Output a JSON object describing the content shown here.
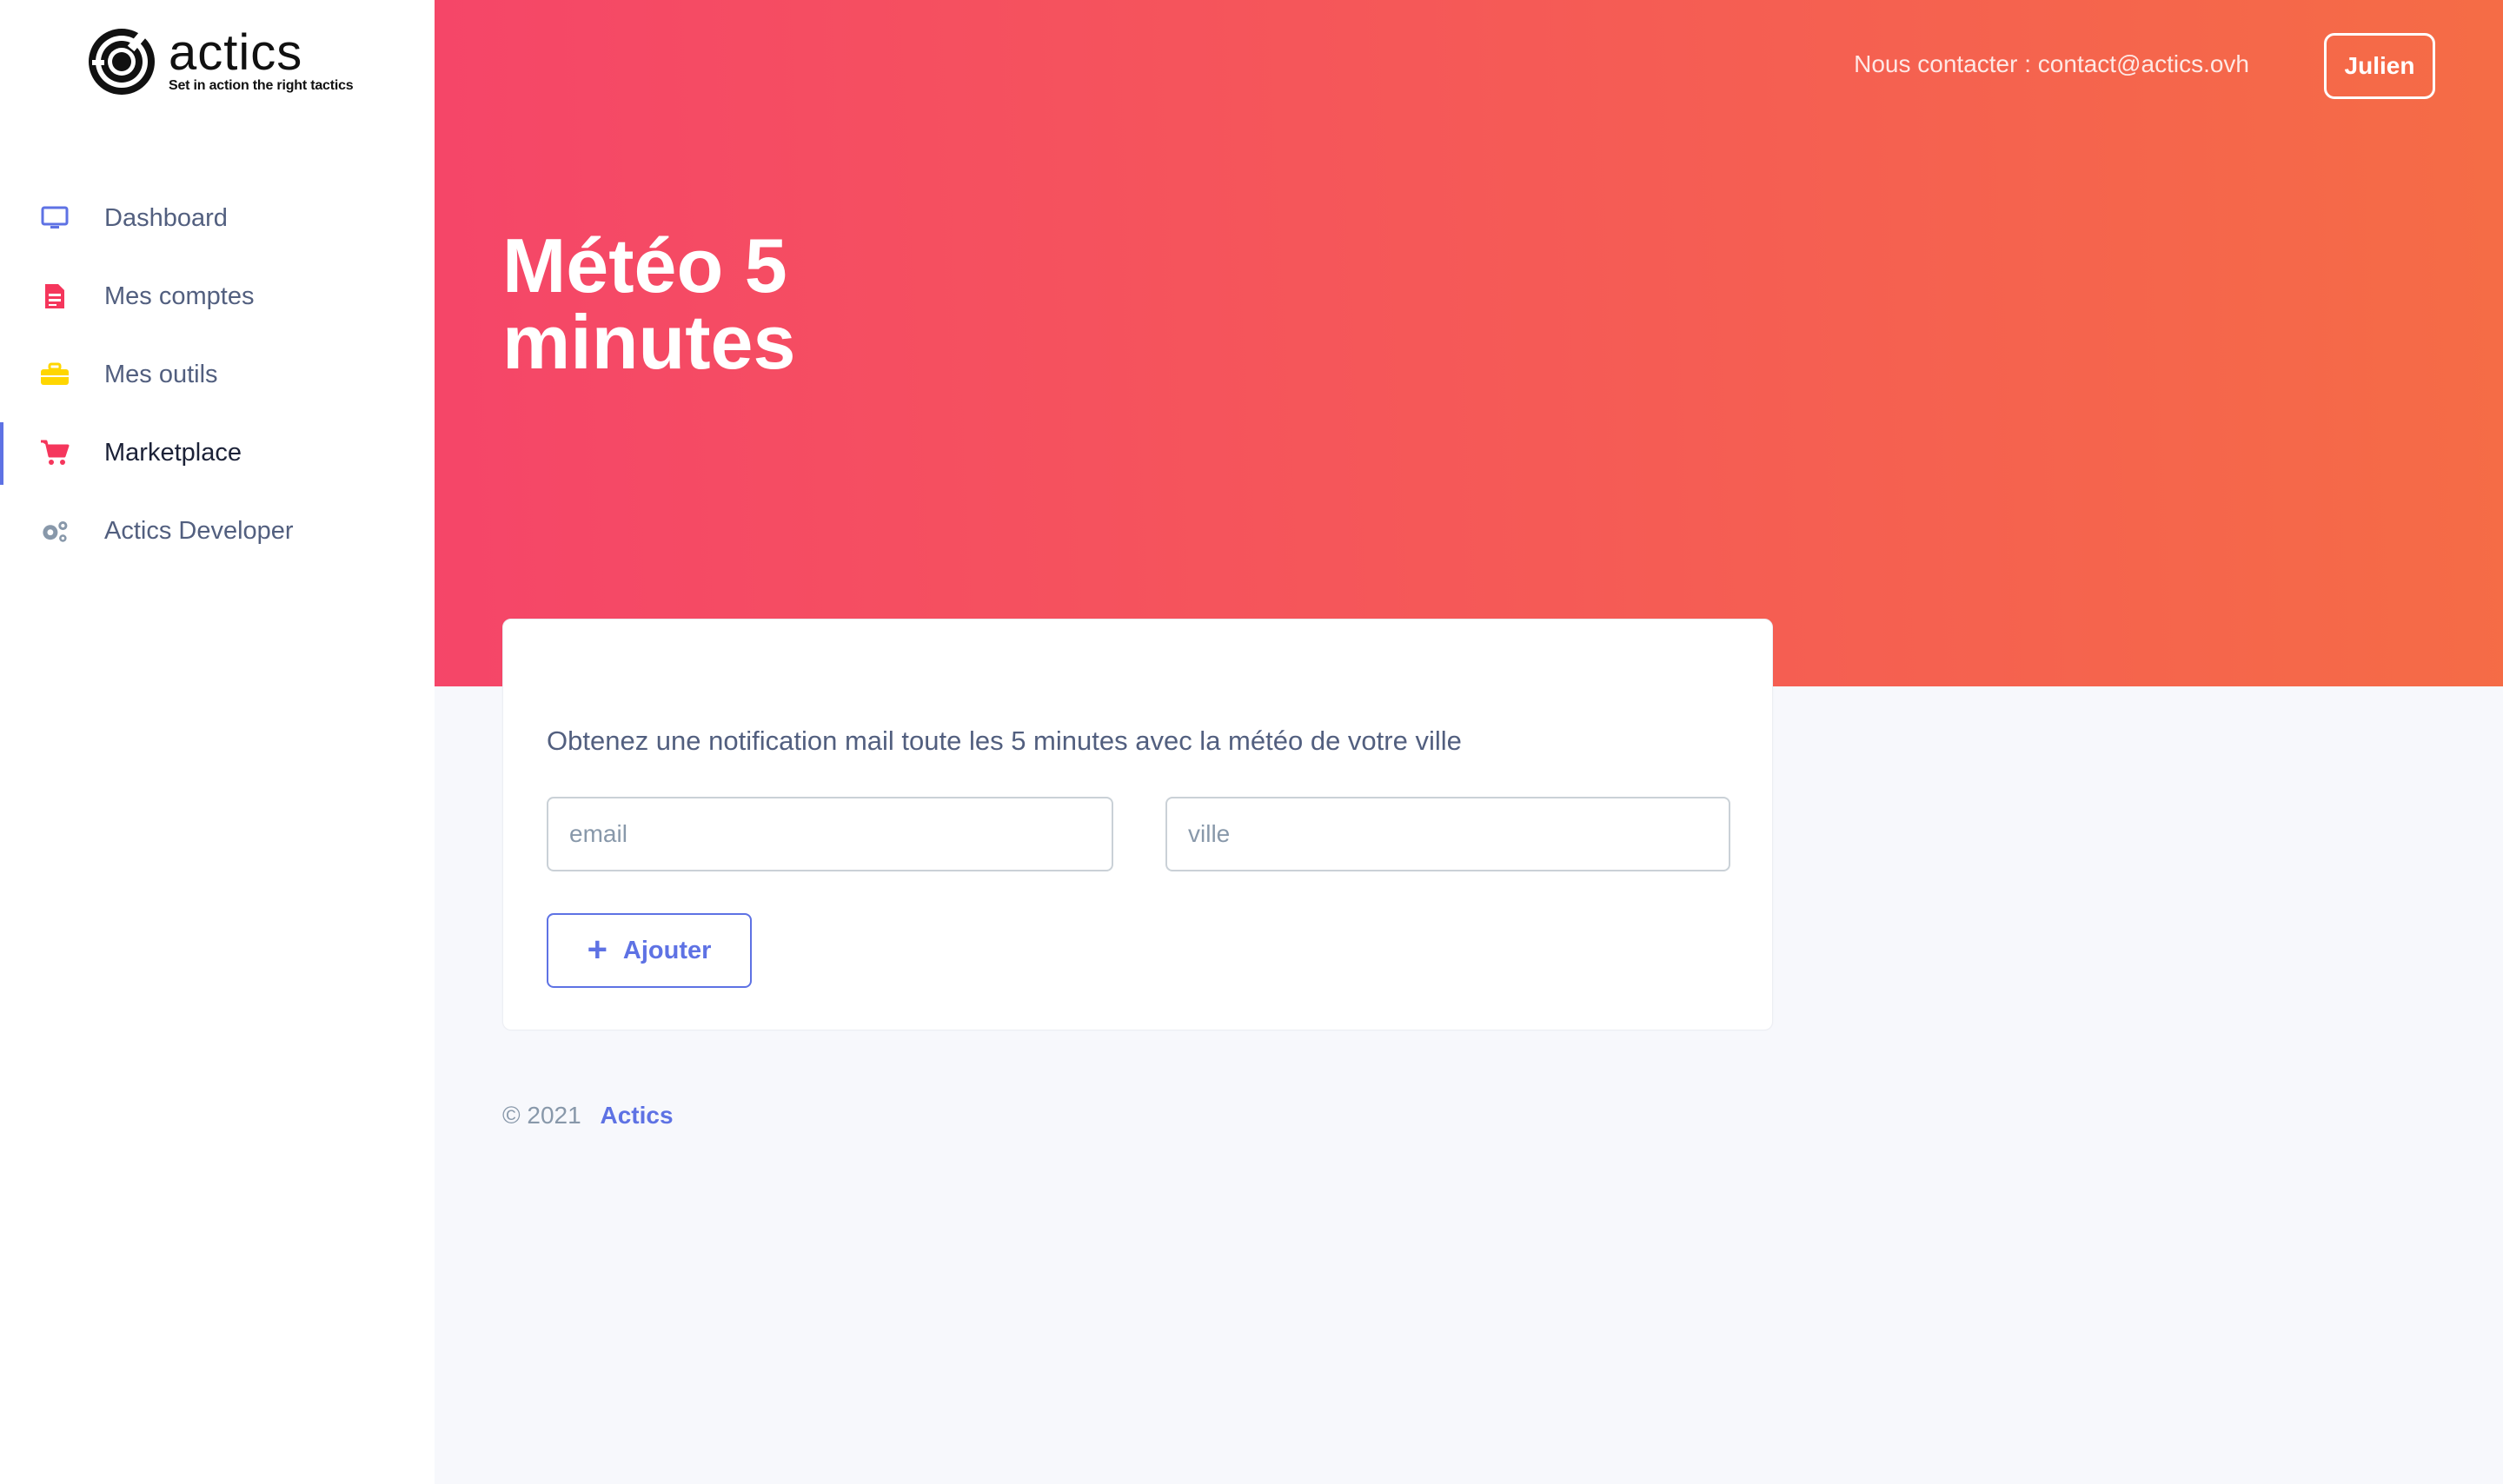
{
  "brand": {
    "name": "actics",
    "tagline": "Set in action the right tactics"
  },
  "sidebar": {
    "items": [
      {
        "label": "Dashboard",
        "icon": "monitor-icon",
        "color": "#5e72e4",
        "active": false
      },
      {
        "label": "Mes comptes",
        "icon": "document-icon",
        "color": "#f5365c",
        "active": false
      },
      {
        "label": "Mes outils",
        "icon": "toolbox-icon",
        "color": "#ffd600",
        "active": false
      },
      {
        "label": "Marketplace",
        "icon": "cart-icon",
        "color": "#f5365c",
        "active": true
      },
      {
        "label": "Actics Developer",
        "icon": "gears-icon",
        "color": "#8898aa",
        "active": false
      }
    ]
  },
  "header": {
    "contact": "Nous contacter : contact@actics.ovh",
    "user": "Julien",
    "title_line1": "Météo 5",
    "title_line2": "minutes",
    "gradient": [
      "#f5365c",
      "#f56036"
    ]
  },
  "card": {
    "description": "Obtenez une notification mail toute les 5 minutes avec la météo de votre ville",
    "email_placeholder": "email",
    "ville_placeholder": "ville",
    "add_label": "Ajouter",
    "add_icon": "plus-icon"
  },
  "footer": {
    "copyright": "© 2021",
    "link": "Actics"
  },
  "colors": {
    "accent": "#5e72e4",
    "text": "#525f7f",
    "muted": "#8898aa"
  }
}
